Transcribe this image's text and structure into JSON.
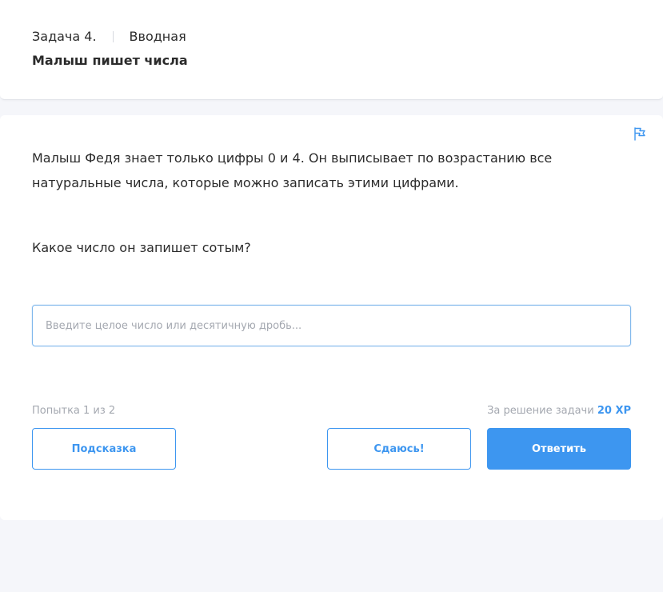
{
  "header": {
    "task_number": "Задача 4.",
    "task_category": "Вводная",
    "task_title": "Малыш пишет числа"
  },
  "task": {
    "statement": "Малыш Федя знает только цифры 0 и 4. Он выписывает по возрастанию все натуральные числа, которые можно записать этими цифрами.",
    "question": "Какое число он запишет сотым?",
    "answer_placeholder": "Введите целое число или десятичную дробь...",
    "answer_value": ""
  },
  "footer": {
    "attempt": "Попытка 1 из 2",
    "reward_label": "За решение задачи",
    "reward_value": "20 XP",
    "hint_label": "Подсказка",
    "give_up_label": "Сдаюсь!",
    "submit_label": "Ответить"
  },
  "icons": {
    "flag": "flag-icon"
  },
  "colors": {
    "accent": "#3d96f0",
    "text": "#2b2b2b",
    "muted": "#a4a8b0",
    "background": "#f5f6fa"
  }
}
